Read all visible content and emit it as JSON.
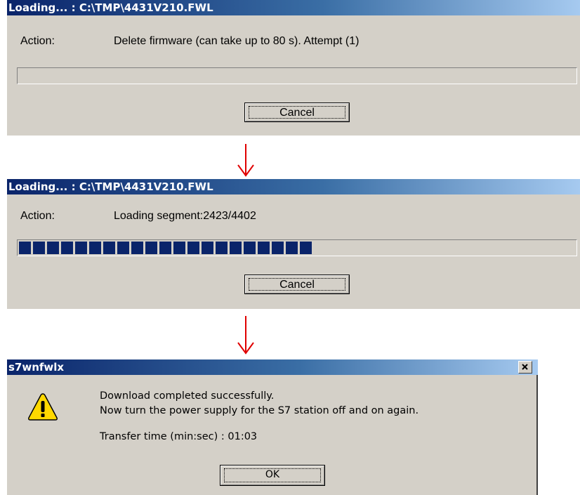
{
  "dialog1": {
    "title": "Loading... : C:\\TMP\\4431V210.FWL",
    "action_label": "Action:",
    "action_text": "Delete firmware (can take up to 80 s). Attempt (1)",
    "progress": 0,
    "cancel_label": "Cancel"
  },
  "dialog2": {
    "title": "Loading... : C:\\TMP\\4431V210.FWL",
    "action_label": "Action:",
    "action_text": "Loading segment:2423/4402",
    "progress": 0.55,
    "cancel_label": "Cancel"
  },
  "dialog3": {
    "title": "s7wnfwlx",
    "icon": "warning-icon",
    "message_line1": "Download completed successfully.",
    "message_line2": "Now turn the power supply for the S7 station off and on again.",
    "transfer_time": "Transfer time (min:sec) : 01:03",
    "ok_label": "OK",
    "close_icon": "close-icon"
  },
  "colors": {
    "dialog_bg": "#d4d0c8",
    "titlebar_start": "#0a246a",
    "titlebar_end": "#a6caf0",
    "progress_fill": "#0a246a",
    "arrow": "#e00000",
    "warning_yellow": "#ffd800"
  }
}
